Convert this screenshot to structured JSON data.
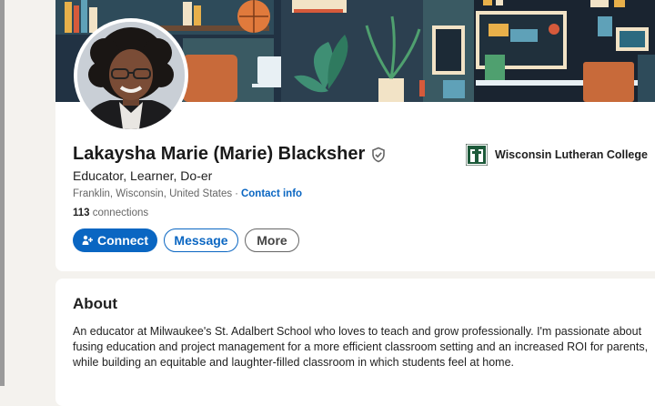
{
  "profile": {
    "name": "Lakaysha Marie (Marie) Blacksher",
    "headline": "Educator, Learner, Do-er",
    "location": "Franklin, Wisconsin, United States",
    "separator": "·",
    "contact_label": "Contact info",
    "connections_count": "113",
    "connections_label": " connections",
    "organization": "Wisconsin Lutheran College"
  },
  "actions": {
    "connect_label": "Connect",
    "message_label": "Message",
    "more_label": "More"
  },
  "about": {
    "title": "About",
    "lines": [
      "An educator at Milwaukee's St. Adalbert School who loves to teach and grow professionally. I'm passionate about",
      "fusing education and project management for a more efficient classroom setting and an increased ROI for parents,",
      "while building an equitable and laughter-filled classroom in which students feel at home."
    ]
  },
  "icons": {
    "verified": "shield-check-icon",
    "connect": "person-add-icon",
    "org": "college-logo-icon"
  },
  "colors": {
    "primary": "#0a66c2",
    "banner": "#213243"
  }
}
